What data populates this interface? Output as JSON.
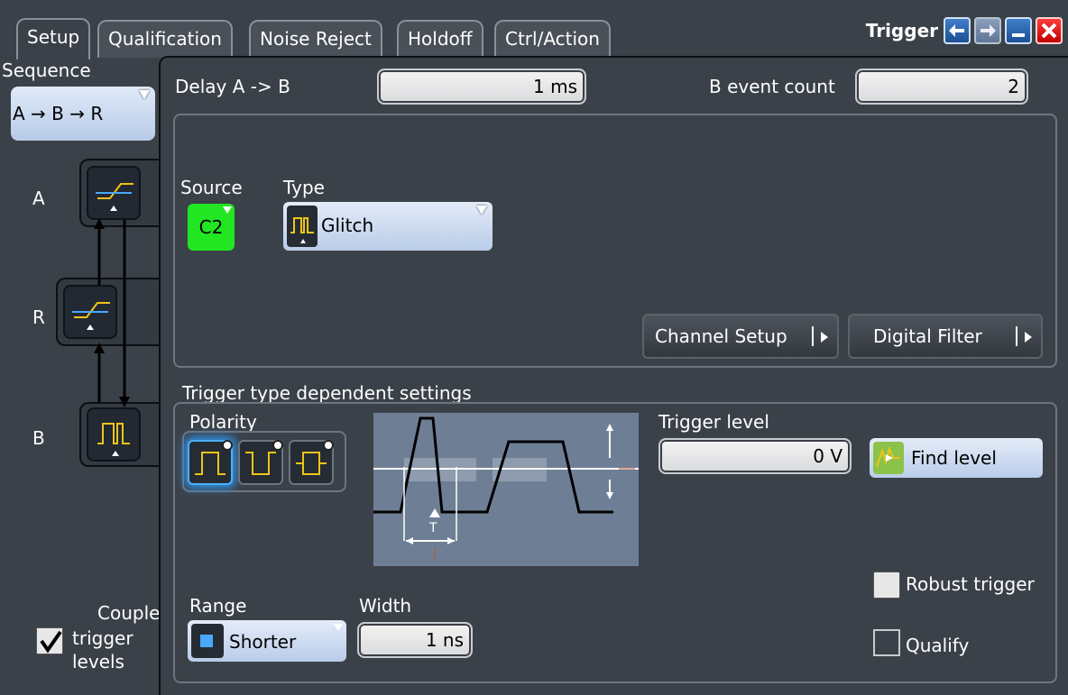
{
  "window": {
    "title": "Trigger",
    "tabs": [
      "Setup",
      "Qualification",
      "Noise Reject",
      "Holdoff",
      "Ctrl/Action"
    ],
    "active_tab": "Setup"
  },
  "sequence": {
    "label": "Sequence",
    "value": "A → B → R",
    "nodes": {
      "a": "A",
      "r": "R",
      "b": "B"
    }
  },
  "couple": {
    "label_line1": "Couple",
    "label_line2": "trigger",
    "label_line3": "levels",
    "checked": true
  },
  "delay": {
    "label": "Delay A -> B",
    "value": "1 ms"
  },
  "b_event": {
    "label": "B event count",
    "value": "2"
  },
  "source": {
    "label": "Source",
    "value": "C2",
    "color": "#22e622"
  },
  "type": {
    "label": "Type",
    "value": "Glitch"
  },
  "buttons": {
    "channel_setup": "Channel Setup",
    "digital_filter": "Digital Filter",
    "find_level": "Find level"
  },
  "trigger_settings": {
    "section_label": "Trigger type dependent settings",
    "polarity_label": "Polarity",
    "polarity_options": [
      "positive",
      "negative",
      "either"
    ],
    "polarity_selected": "positive",
    "diagram_t_label": "T",
    "trigger_level_label": "Trigger level",
    "trigger_level_value": "0 V",
    "range_label": "Range",
    "range_value": "Shorter",
    "width_label": "Width",
    "width_value": "1 ns",
    "robust_trigger_label": "Robust trigger",
    "robust_trigger_checked": false,
    "qualify_label": "Qualify",
    "qualify_checked": false
  },
  "colors": {
    "signal_yellow": "#f0c419",
    "signal_blue": "#4aa8ff",
    "accent_blue": "#2f8fe0"
  }
}
